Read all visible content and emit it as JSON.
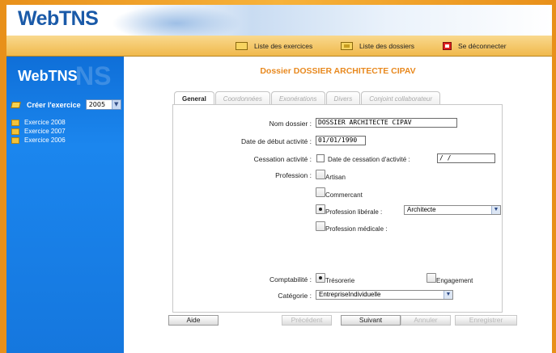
{
  "header": {
    "logo": "WebTNS"
  },
  "toolbar": {
    "exercices_label": "Liste des exercices",
    "dossiers_label": "Liste des dossiers",
    "logout_label": "Se déconnecter"
  },
  "sidebar": {
    "logo": "WebTNS",
    "bg_text": "NS",
    "creer_label": "Créer l'exercice",
    "year": "2005",
    "exercices": [
      "Exercice 2008",
      "Exercice 2007",
      "Exercice 2006"
    ]
  },
  "main": {
    "title": "Dossier DOSSIER ARCHITECTE CIPAV",
    "tabs": [
      "General",
      "Coordonnées",
      "Exonérations",
      "Divers",
      "Conjoint collaborateur"
    ],
    "form": {
      "nom_dossier_label": "Nom dossier :",
      "nom_dossier_value": "DOSSIER ARCHITECTE CIPAV",
      "date_debut_label": "Date de début activité :",
      "date_debut_value": "01/01/1990",
      "cessation_label": "Cessation activité :",
      "date_cessation_label": "Date de cessation d'activité :",
      "date_cessation_value": "  / /",
      "profession_label": "Profession :",
      "professions": [
        "Artisan",
        "Commercant",
        "Profession libérale :",
        "Profession médicale :"
      ],
      "profession_liberale_value": "Architecte",
      "comptabilite_label": "Comptabilité :",
      "comptabilite_options": [
        "Trésorerie",
        "Engagement"
      ],
      "categorie_label": "Catégorie :",
      "categorie_value": "EntrepriseIndividuelle"
    },
    "buttons": {
      "aide": "Aide",
      "precedent": "Précédent",
      "suivant": "Suivant",
      "annuler": "Annuler",
      "enregistrer": "Enregistrer"
    }
  },
  "colors": {
    "accent": "#e8891f",
    "sidebar": "#1b86ee",
    "logo": "#1a5aa8"
  }
}
